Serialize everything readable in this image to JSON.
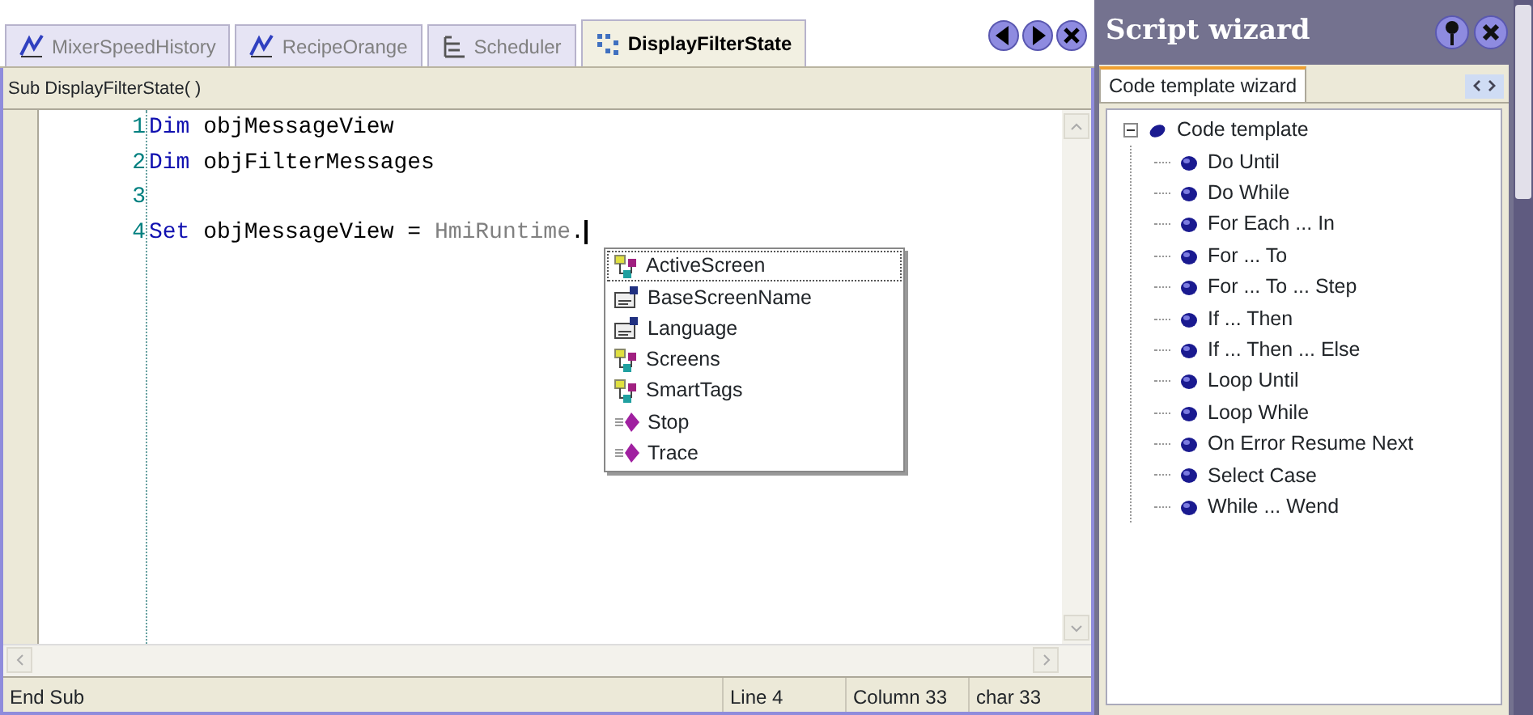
{
  "editor_tabs": [
    {
      "label": "MixerSpeedHistory",
      "kind": "chart",
      "selected": false
    },
    {
      "label": "RecipeOrange",
      "kind": "chart",
      "selected": false
    },
    {
      "label": "Scheduler",
      "kind": "scheduler",
      "selected": false
    },
    {
      "label": "DisplayFilterState",
      "kind": "script",
      "selected": true
    }
  ],
  "procedure_header": "Sub DisplayFilterState( )",
  "code_lines": [
    {
      "number": "1",
      "tokens": [
        {
          "kind": "keyword",
          "text": "Dim"
        },
        {
          "kind": "plain",
          "text": " objMessageView"
        }
      ]
    },
    {
      "number": "2",
      "tokens": [
        {
          "kind": "keyword",
          "text": "Dim"
        },
        {
          "kind": "plain",
          "text": " objFilterMessages"
        }
      ]
    },
    {
      "number": "3"
    },
    {
      "number": "4",
      "tokens": [
        {
          "kind": "keyword",
          "text": "Set"
        },
        {
          "kind": "plain",
          "text": " objMessageView = "
        },
        {
          "kind": "object",
          "text": "HmiRuntime"
        },
        {
          "kind": "plain",
          "text": "."
        }
      ]
    }
  ],
  "autocomplete": [
    {
      "label": "ActiveScreen",
      "kind": "object",
      "selected": true
    },
    {
      "label": "BaseScreenName",
      "kind": "property",
      "selected": false
    },
    {
      "label": "Language",
      "kind": "property",
      "selected": false
    },
    {
      "label": "Screens",
      "kind": "object",
      "selected": false
    },
    {
      "label": "SmartTags",
      "kind": "object",
      "selected": false
    },
    {
      "label": "Stop",
      "kind": "method",
      "selected": false
    },
    {
      "label": "Trace",
      "kind": "method",
      "selected": false
    }
  ],
  "status_bar": [
    "End Sub",
    "Line 4",
    "Column 33",
    "char 33"
  ],
  "script_wizard": {
    "title": "Script wizard",
    "tabs": [
      {
        "label": "Code template wizard",
        "selected": true
      }
    ],
    "tree": [
      {
        "label": "Code template",
        "expanded": true,
        "children": [
          {
            "label": "Do Until"
          },
          {
            "label": "Do While"
          },
          {
            "label": "For Each ... In"
          },
          {
            "label": "For ... To"
          },
          {
            "label": "For ... To ... Step"
          },
          {
            "label": "If ... Then"
          },
          {
            "label": "If ... Then ... Else"
          },
          {
            "label": "Loop Until"
          },
          {
            "label": "Loop While"
          },
          {
            "label": "On Error Resume Next"
          },
          {
            "label": "Select Case"
          },
          {
            "label": "While ... Wend"
          }
        ]
      }
    ]
  }
}
